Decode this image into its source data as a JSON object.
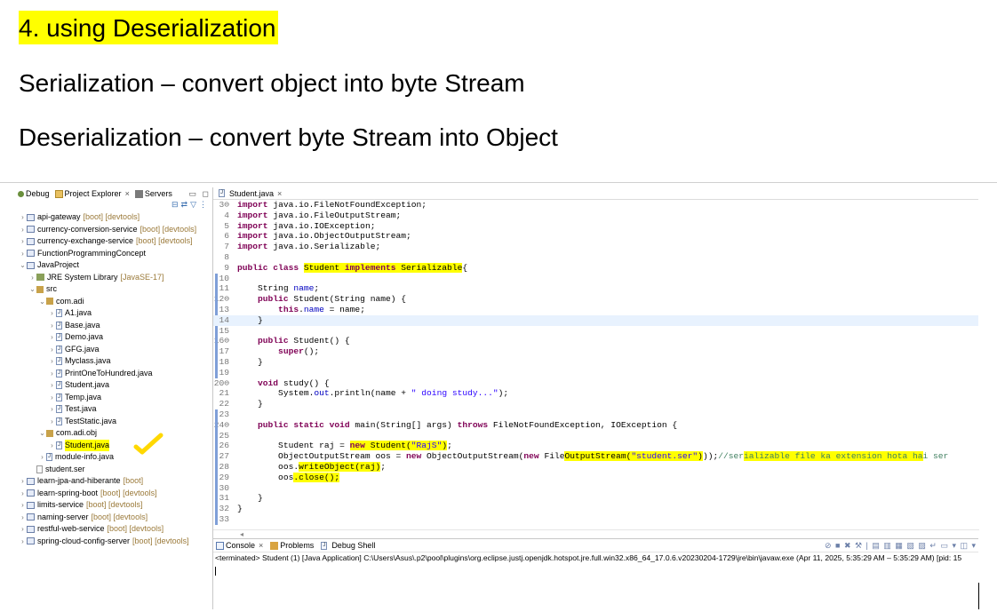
{
  "slide": {
    "title": "4. using Deserialization",
    "line1": "Serialization – convert object into byte Stream",
    "line2": "Deserialization – convert byte Stream into Object"
  },
  "left_pane": {
    "tabs": [
      "Debug",
      "Project Explorer",
      "Servers"
    ],
    "active_tab": "Project Explorer",
    "tree": [
      {
        "twisty": ">",
        "icon": "project",
        "label": "api-gateway",
        "deco": "[boot] [devtools]"
      },
      {
        "twisty": ">",
        "icon": "project",
        "label": "currency-conversion-service",
        "deco": "[boot] [devtools]"
      },
      {
        "twisty": ">",
        "icon": "project",
        "label": "currency-exchange-service",
        "deco": "[boot] [devtools]"
      },
      {
        "twisty": ">",
        "icon": "project",
        "label": "FunctionProgrammingConcept",
        "deco": ""
      },
      {
        "twisty": "v",
        "icon": "project",
        "label": "JavaProject",
        "deco": ""
      },
      {
        "twisty": ">",
        "icon": "library",
        "label": "JRE System Library",
        "deco": "[JavaSE-17]"
      },
      {
        "twisty": "v",
        "icon": "package",
        "label": "src",
        "deco": ""
      },
      {
        "twisty": "v",
        "icon": "package",
        "label": "com.adi",
        "deco": ""
      },
      {
        "twisty": ">",
        "icon": "java",
        "label": "A1.java",
        "deco": ""
      },
      {
        "twisty": ">",
        "icon": "java",
        "label": "Base.java",
        "deco": ""
      },
      {
        "twisty": ">",
        "icon": "java",
        "label": "Demo.java",
        "deco": ""
      },
      {
        "twisty": ">",
        "icon": "java",
        "label": "GFG.java",
        "deco": ""
      },
      {
        "twisty": ">",
        "icon": "java",
        "label": "Myclass.java",
        "deco": ""
      },
      {
        "twisty": ">",
        "icon": "java",
        "label": "PrintOneToHundred.java",
        "deco": ""
      },
      {
        "twisty": ">",
        "icon": "java",
        "label": "Student.java",
        "deco": ""
      },
      {
        "twisty": ">",
        "icon": "java",
        "label": "Temp.java",
        "deco": ""
      },
      {
        "twisty": ">",
        "icon": "java",
        "label": "Test.java",
        "deco": ""
      },
      {
        "twisty": ">",
        "icon": "java",
        "label": "TestStatic.java",
        "deco": ""
      },
      {
        "twisty": "v",
        "icon": "package",
        "label": "com.adi.obj",
        "deco": ""
      },
      {
        "twisty": ">",
        "icon": "java",
        "label": "Student.java",
        "deco": "",
        "highlight": true
      },
      {
        "twisty": ">",
        "icon": "java",
        "label": "module-info.java",
        "deco": ""
      },
      {
        "twisty": "",
        "icon": "file",
        "label": "student.ser",
        "deco": ""
      },
      {
        "twisty": ">",
        "icon": "project",
        "label": "learn-jpa-and-hiberante",
        "deco": "[boot]"
      },
      {
        "twisty": ">",
        "icon": "project",
        "label": "learn-spring-boot",
        "deco": "[boot] [devtools]"
      },
      {
        "twisty": ">",
        "icon": "project",
        "label": "limits-service",
        "deco": "[boot] [devtools]"
      },
      {
        "twisty": ">",
        "icon": "project",
        "label": "naming-server",
        "deco": "[boot] [devtools]"
      },
      {
        "twisty": ">",
        "icon": "project",
        "label": "restful-web-service",
        "deco": "[boot] [devtools]"
      },
      {
        "twisty": ">",
        "icon": "project",
        "label": "spring-cloud-config-server",
        "deco": "[boot] [devtools]"
      }
    ]
  },
  "editor": {
    "tab": "Student.java",
    "lines": [
      {
        "n": "3",
        "fold": "⊖",
        "segs": [
          [
            "kw",
            "import"
          ],
          [
            "",
            "java.io.FileNotFoundException;"
          ]
        ]
      },
      {
        "n": "4",
        "segs": [
          [
            "kw",
            "import"
          ],
          [
            "",
            "java.io.FileOutputStream;"
          ]
        ]
      },
      {
        "n": "5",
        "segs": [
          [
            "kw",
            "import"
          ],
          [
            "",
            "java.io.IOException;"
          ]
        ]
      },
      {
        "n": "6",
        "segs": [
          [
            "kw",
            "import"
          ],
          [
            "",
            "java.io.ObjectOutputStream;"
          ]
        ]
      },
      {
        "n": "7",
        "segs": [
          [
            "kw",
            "import"
          ],
          [
            "",
            "java.io.Serializable;"
          ]
        ]
      },
      {
        "n": "8",
        "segs": []
      },
      {
        "n": "9",
        "segs": [
          [
            "kw",
            "public class "
          ],
          [
            "hl",
            "Student "
          ],
          [
            "kwhl",
            "implements"
          ],
          [
            "hl",
            " Serializable"
          ],
          [
            "",
            "{"
          ]
        ]
      },
      {
        "n": "10",
        "segs": []
      },
      {
        "n": "11",
        "segs": [
          [
            "",
            "    String "
          ],
          [
            "fld",
            "name"
          ],
          [
            "",
            ";"
          ]
        ]
      },
      {
        "n": "12",
        "fold": "⊖",
        "segs": [
          [
            "kw",
            "    public "
          ],
          [
            "",
            "Student(String name) {"
          ]
        ]
      },
      {
        "n": "13",
        "segs": [
          [
            "kw",
            "        this"
          ],
          [
            "",
            "."
          ],
          [
            "fld",
            "name"
          ],
          [
            "",
            " = name;"
          ]
        ]
      },
      {
        "n": "14",
        "current": true,
        "segs": [
          [
            "",
            "    }"
          ]
        ]
      },
      {
        "n": "15",
        "segs": []
      },
      {
        "n": "16",
        "fold": "⊖",
        "segs": [
          [
            "kw",
            "    public "
          ],
          [
            "",
            "Student() {"
          ]
        ]
      },
      {
        "n": "17",
        "segs": [
          [
            "kw",
            "        super"
          ],
          [
            "",
            "();"
          ]
        ]
      },
      {
        "n": "18",
        "segs": [
          [
            "",
            "    }"
          ]
        ]
      },
      {
        "n": "19",
        "segs": []
      },
      {
        "n": "20",
        "fold": "⊖",
        "segs": [
          [
            "kw",
            "    void "
          ],
          [
            "",
            "study() {"
          ]
        ]
      },
      {
        "n": "21",
        "segs": [
          [
            "",
            "        System."
          ],
          [
            "fld",
            "out"
          ],
          [
            "",
            ".println("
          ],
          [
            "",
            "name + "
          ],
          [
            "str",
            "\" doing study...\""
          ],
          [
            "",
            ");"
          ]
        ]
      },
      {
        "n": "22",
        "segs": [
          [
            "",
            "    }"
          ]
        ]
      },
      {
        "n": "23",
        "segs": []
      },
      {
        "n": "24",
        "fold": "⊖",
        "segs": [
          [
            "kw",
            "    public static void "
          ],
          [
            "",
            "main(String[] args) "
          ],
          [
            "kw",
            "throws "
          ],
          [
            "",
            "FileNotFoundException, IOException {"
          ]
        ]
      },
      {
        "n": "25",
        "segs": []
      },
      {
        "n": "26",
        "segs": [
          [
            "",
            "        Student raj = "
          ],
          [
            "kwhl",
            "new"
          ],
          [
            "hl",
            " Student("
          ],
          [
            "strhl",
            "\"RajS\""
          ],
          [
            "hl",
            ")"
          ],
          [
            "",
            ";"
          ]
        ]
      },
      {
        "n": "27",
        "segs": [
          [
            "",
            "        ObjectOutputStream oos = "
          ],
          [
            "kw",
            "new "
          ],
          [
            "",
            "ObjectOutputStream("
          ],
          [
            "kw",
            "new "
          ],
          [
            "",
            "File"
          ],
          [
            "hl",
            "OutputStream("
          ],
          [
            "strhl",
            "\"student.ser\""
          ],
          [
            "hl",
            ")"
          ],
          [
            "",
            "));"
          ],
          [
            "cmt",
            "//ser"
          ],
          [
            "cmthl",
            "ializable file ka extension hota ha"
          ],
          [
            "cmt",
            "i ser"
          ]
        ]
      },
      {
        "n": "28",
        "segs": [
          [
            "",
            "        oos."
          ],
          [
            "hl",
            "writeObject(raj)"
          ],
          [
            "",
            ";"
          ]
        ]
      },
      {
        "n": "29",
        "segs": [
          [
            "",
            "        oos"
          ],
          [
            "hl",
            ".close();"
          ]
        ]
      },
      {
        "n": "30",
        "segs": []
      },
      {
        "n": "31",
        "segs": [
          [
            "",
            "    }"
          ]
        ]
      },
      {
        "n": "32",
        "segs": [
          [
            "",
            "}"
          ]
        ]
      },
      {
        "n": "33",
        "segs": []
      }
    ]
  },
  "console": {
    "tabs": [
      "Console",
      "Problems",
      "Debug Shell"
    ],
    "status": "<terminated> Student (1) [Java Application] C:\\Users\\Asus\\.p2\\pool\\plugins\\org.eclipse.justj.openjdk.hotspot.jre.full.win32.x86_64_17.0.6.v20230204-1729\\jre\\bin\\javaw.exe  (Apr 11, 2025, 5:35:29 AM – 5:35:29 AM) [pid: 15"
  },
  "colors": {
    "highlight": "#ffff00",
    "keyword": "#7f0055",
    "string": "#2a00ff",
    "field": "#0000c0",
    "comment": "#3f7f5f",
    "current_line": "#e8f2fe"
  },
  "icons": [
    "debug-icon",
    "project-explorer-icon",
    "servers-icon",
    "java-file-icon",
    "package-icon",
    "project-icon",
    "checkmark-icon"
  ]
}
